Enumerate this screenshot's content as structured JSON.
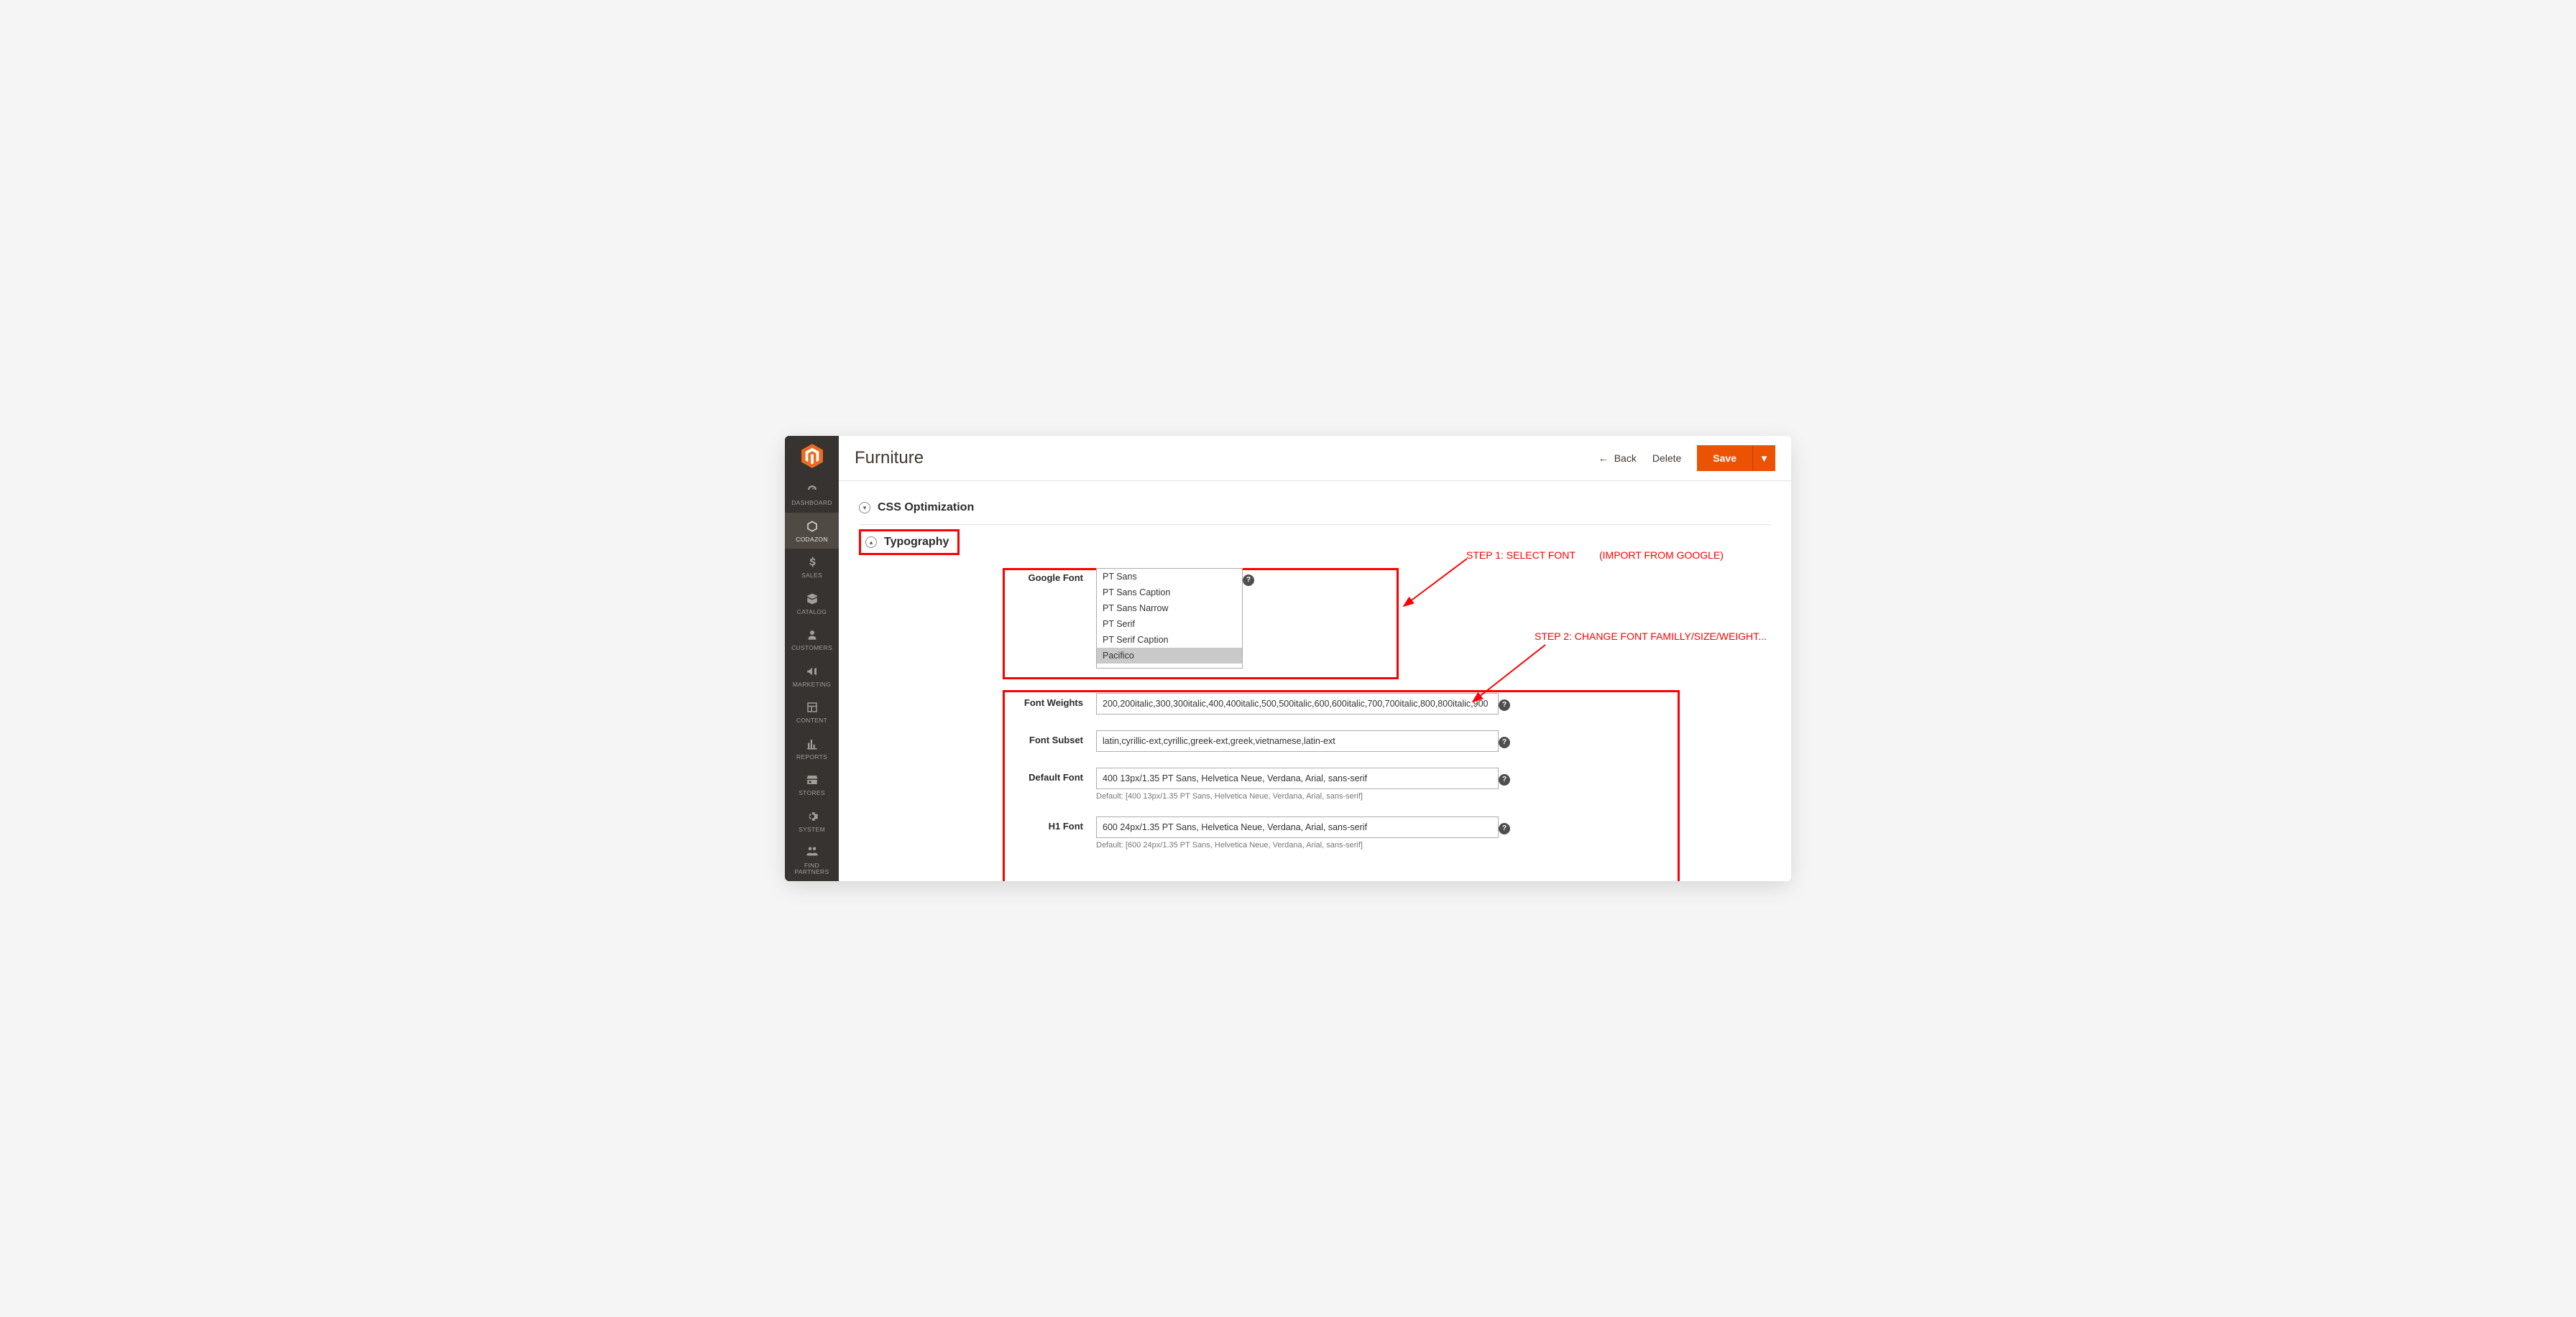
{
  "sidebar": {
    "items": [
      {
        "label": "DASHBOARD"
      },
      {
        "label": "CODAZON"
      },
      {
        "label": "SALES"
      },
      {
        "label": "CATALOG"
      },
      {
        "label": "CUSTOMERS"
      },
      {
        "label": "MARKETING"
      },
      {
        "label": "CONTENT"
      },
      {
        "label": "REPORTS"
      },
      {
        "label": "STORES"
      },
      {
        "label": "SYSTEM"
      },
      {
        "label": "FIND PARTNERS"
      }
    ]
  },
  "header": {
    "title": "Furniture",
    "back": "Back",
    "delete": "Delete",
    "save": "Save"
  },
  "sections": {
    "css": "CSS Optimization",
    "typo": "Typography"
  },
  "annotations": {
    "step1": "STEP 1: SELECT FONT",
    "step1_note": "(IMPORT FROM GOOGLE)",
    "step2": "STEP 2: CHANGE FONT FAMILLY/SIZE/WEIGHT..."
  },
  "form": {
    "google_font": {
      "label": "Google Font",
      "options": [
        "PT Sans",
        "PT Sans Caption",
        "PT Sans Narrow",
        "PT Serif",
        "PT Serif Caption",
        "Pacifico"
      ]
    },
    "font_weights": {
      "label": "Font Weights",
      "value": "200,200italic,300,300italic,400,400italic,500,500italic,600,600italic,700,700italic,800,800italic,900"
    },
    "font_subset": {
      "label": "Font Subset",
      "value": "latin,cyrillic-ext,cyrillic,greek-ext,greek,vietnamese,latin-ext"
    },
    "default_font": {
      "label": "Default Font",
      "value": "400 13px/1.35 PT Sans, Helvetica Neue, Verdana, Arial, sans-serif",
      "hint": "Default: [400 13px/1.35 PT Sans, Helvetica Neue, Verdana, Arial, sans-serif]"
    },
    "h1_font": {
      "label": "H1 Font",
      "value": "600 24px/1.35 PT Sans, Helvetica Neue, Verdana, Arial, sans-serif",
      "hint": "Default: [600 24px/1.35 PT Sans, Helvetica Neue, Verdana, Arial, sans-serif]"
    }
  }
}
